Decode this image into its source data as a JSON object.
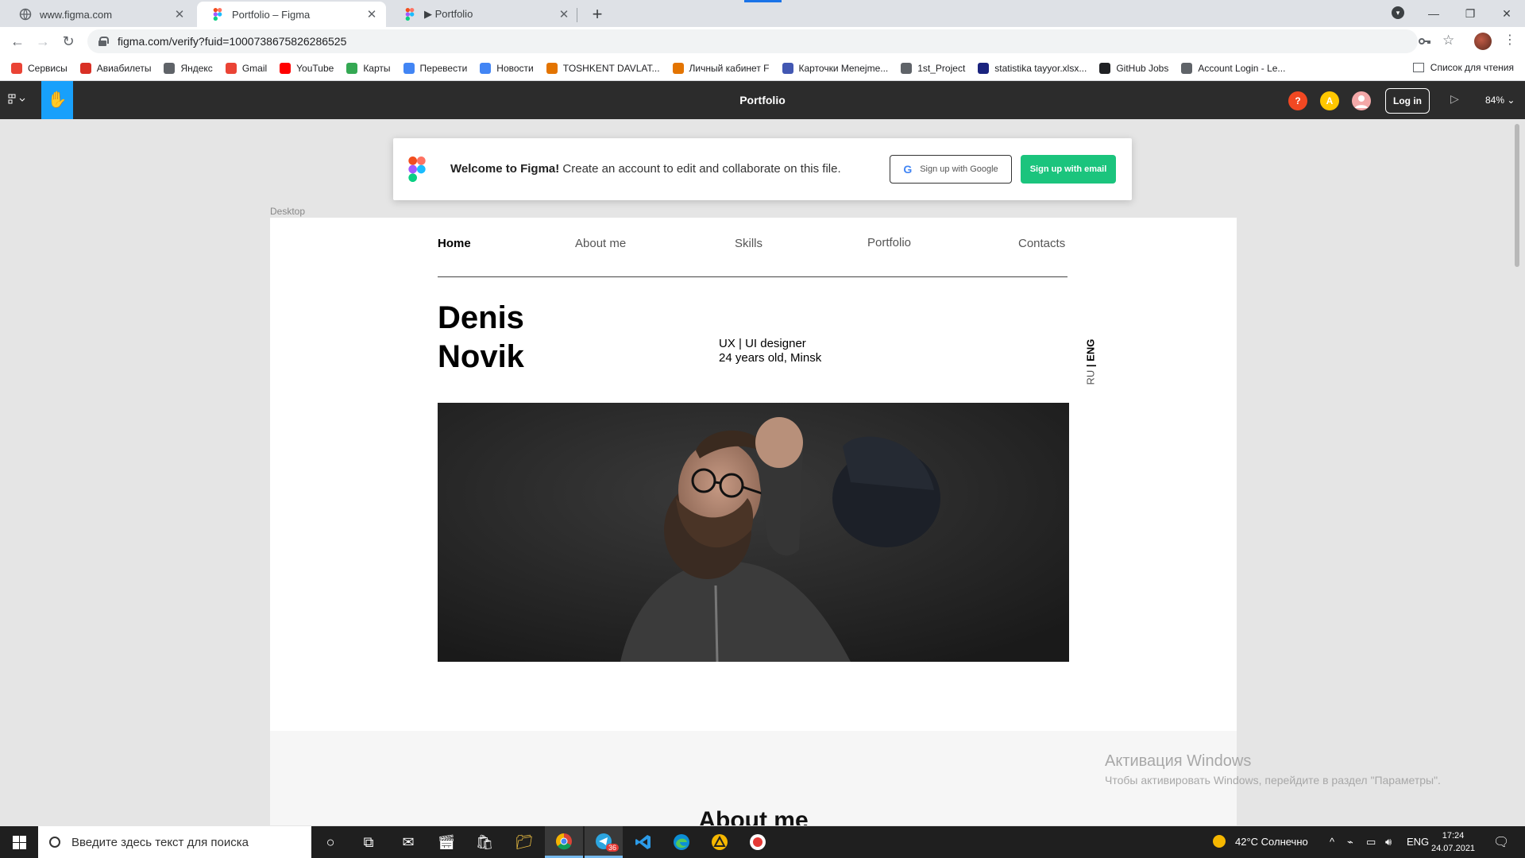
{
  "browser": {
    "tabs": [
      {
        "title": "www.figma.com",
        "active": false
      },
      {
        "title": "Portfolio – Figma",
        "active": true
      },
      {
        "title": "▶ Portfolio",
        "active": false
      }
    ],
    "url": "figma.com/verify?fuid=1000738675826286525",
    "bookmarks": [
      {
        "label": "Сервисы",
        "icon": "apps-grid-icon",
        "color": "#ea4335"
      },
      {
        "label": "Авиабилеты",
        "icon": "plane-icon",
        "color": "#d93025"
      },
      {
        "label": "Яндекс",
        "icon": "globe-icon",
        "color": "#5f6368"
      },
      {
        "label": "Gmail",
        "icon": "gmail-icon",
        "color": "#ea4335"
      },
      {
        "label": "YouTube",
        "icon": "youtube-icon",
        "color": "#ff0000"
      },
      {
        "label": "Карты",
        "icon": "maps-icon",
        "color": "#34a853"
      },
      {
        "label": "Перевести",
        "icon": "translate-icon",
        "color": "#4285f4"
      },
      {
        "label": "Новости",
        "icon": "news-icon",
        "color": "#4285f4"
      },
      {
        "label": "TOSHKENT DAVLAT...",
        "icon": "university-icon",
        "color": "#e37400"
      },
      {
        "label": "Личный кабинет F",
        "icon": "cabinet-icon",
        "color": "#e37400"
      },
      {
        "label": "Карточки Menejme...",
        "icon": "quizlet-icon",
        "color": "#4257b2"
      },
      {
        "label": "1st_Project",
        "icon": "globe-icon",
        "color": "#5f6368"
      },
      {
        "label": "statistika tayyor.xlsx...",
        "icon": "doc-icon",
        "color": "#1a237e"
      },
      {
        "label": "GitHub Jobs",
        "icon": "github-icon",
        "color": "#202124"
      },
      {
        "label": "Account Login - Le...",
        "icon": "login-icon",
        "color": "#5f6368"
      }
    ],
    "reading_list": "Список для чтения"
  },
  "figma": {
    "file_title": "Portfolio",
    "avatars": [
      {
        "label": "?",
        "color": "#f24822"
      },
      {
        "label": "A",
        "color": "#ffc700"
      },
      {
        "label": "",
        "color": "#f4a8a8"
      }
    ],
    "login": "Log in",
    "zoom": "84%",
    "banner": {
      "welcome": "Welcome to Figma!",
      "text": " Create an account to edit and collaborate on this file.",
      "google_btn": "Sign up with Google",
      "email_btn": "Sign up with email"
    },
    "frame_label": "Desktop"
  },
  "site": {
    "nav": [
      "Home",
      "About me",
      "Skills",
      "Portfolio",
      "Contacts"
    ],
    "first_name": "Denis",
    "last_name": "Novik",
    "role_line1": "UX | UI designer",
    "role_line2": "24 years old, Minsk",
    "lang_ru": "RU",
    "lang_sep": " | ",
    "lang_eng": "ENG",
    "section_about": "About me"
  },
  "windows": {
    "watermark_title": "Активация Windows",
    "watermark_sub": "Чтобы активировать Windows, перейдите в раздел \"Параметры\".",
    "search_placeholder": "Введите здесь текст для поиска",
    "weather": "42°C Солнечно",
    "lang": "ENG",
    "time": "17:24",
    "date": "24.07.2021",
    "telegram_badge": "36"
  }
}
